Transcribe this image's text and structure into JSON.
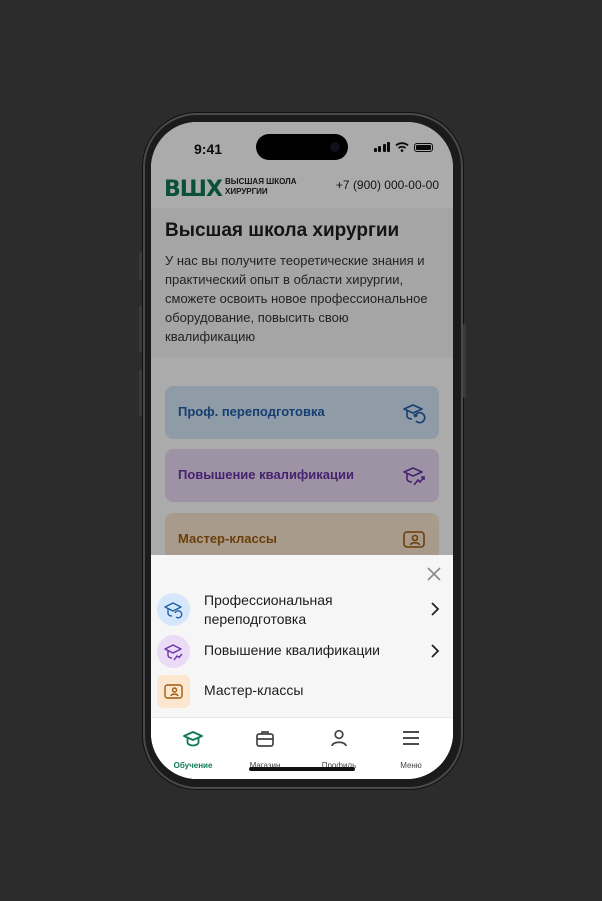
{
  "status_bar": {
    "time": "9:41"
  },
  "header": {
    "logo_mark": "ВШХ",
    "logo_line1": "ВЫСШАЯ ШКОЛА",
    "logo_line2": "ХИРУРГИИ",
    "phone": "+7 (900) 000-00-00"
  },
  "hero": {
    "title": "Высшая школа хирургии",
    "description": "У нас вы получите теоретические знания и практический опыт в области хирургии, сможете освоить новое профессиональное оборудование, повысить свою квалификацию"
  },
  "cards": [
    {
      "label": "Проф. переподготовка",
      "color": "#1f5fa8",
      "icon": "graduation-cap-refresh-icon"
    },
    {
      "label": "Повышение квалификации",
      "color": "#6a33a8",
      "icon": "graduation-cap-arrow-icon"
    },
    {
      "label": "Мастер-классы",
      "color": "#a05d10",
      "icon": "certificate-person-icon"
    }
  ],
  "sheet": {
    "items": [
      {
        "line1": "Профессиональная",
        "line2": "переподготовка",
        "icon": "graduation-cap-refresh-icon"
      },
      {
        "line1": "Повышение квалификации",
        "icon": "graduation-cap-arrow-icon"
      },
      {
        "line1": "Мастер-классы",
        "icon": "certificate-person-icon"
      }
    ]
  },
  "tabbar": {
    "tabs": [
      {
        "label": "Обучение",
        "icon": "graduation-cap-icon",
        "active": true
      },
      {
        "label": "Магазин",
        "icon": "briefcase-icon"
      },
      {
        "label": "Профиль",
        "icon": "user-icon"
      },
      {
        "label": "Меню",
        "icon": "menu-icon"
      }
    ]
  },
  "colors": {
    "brand": "#0f7a52",
    "overlay": "rgba(0,0,0,0.33)"
  }
}
